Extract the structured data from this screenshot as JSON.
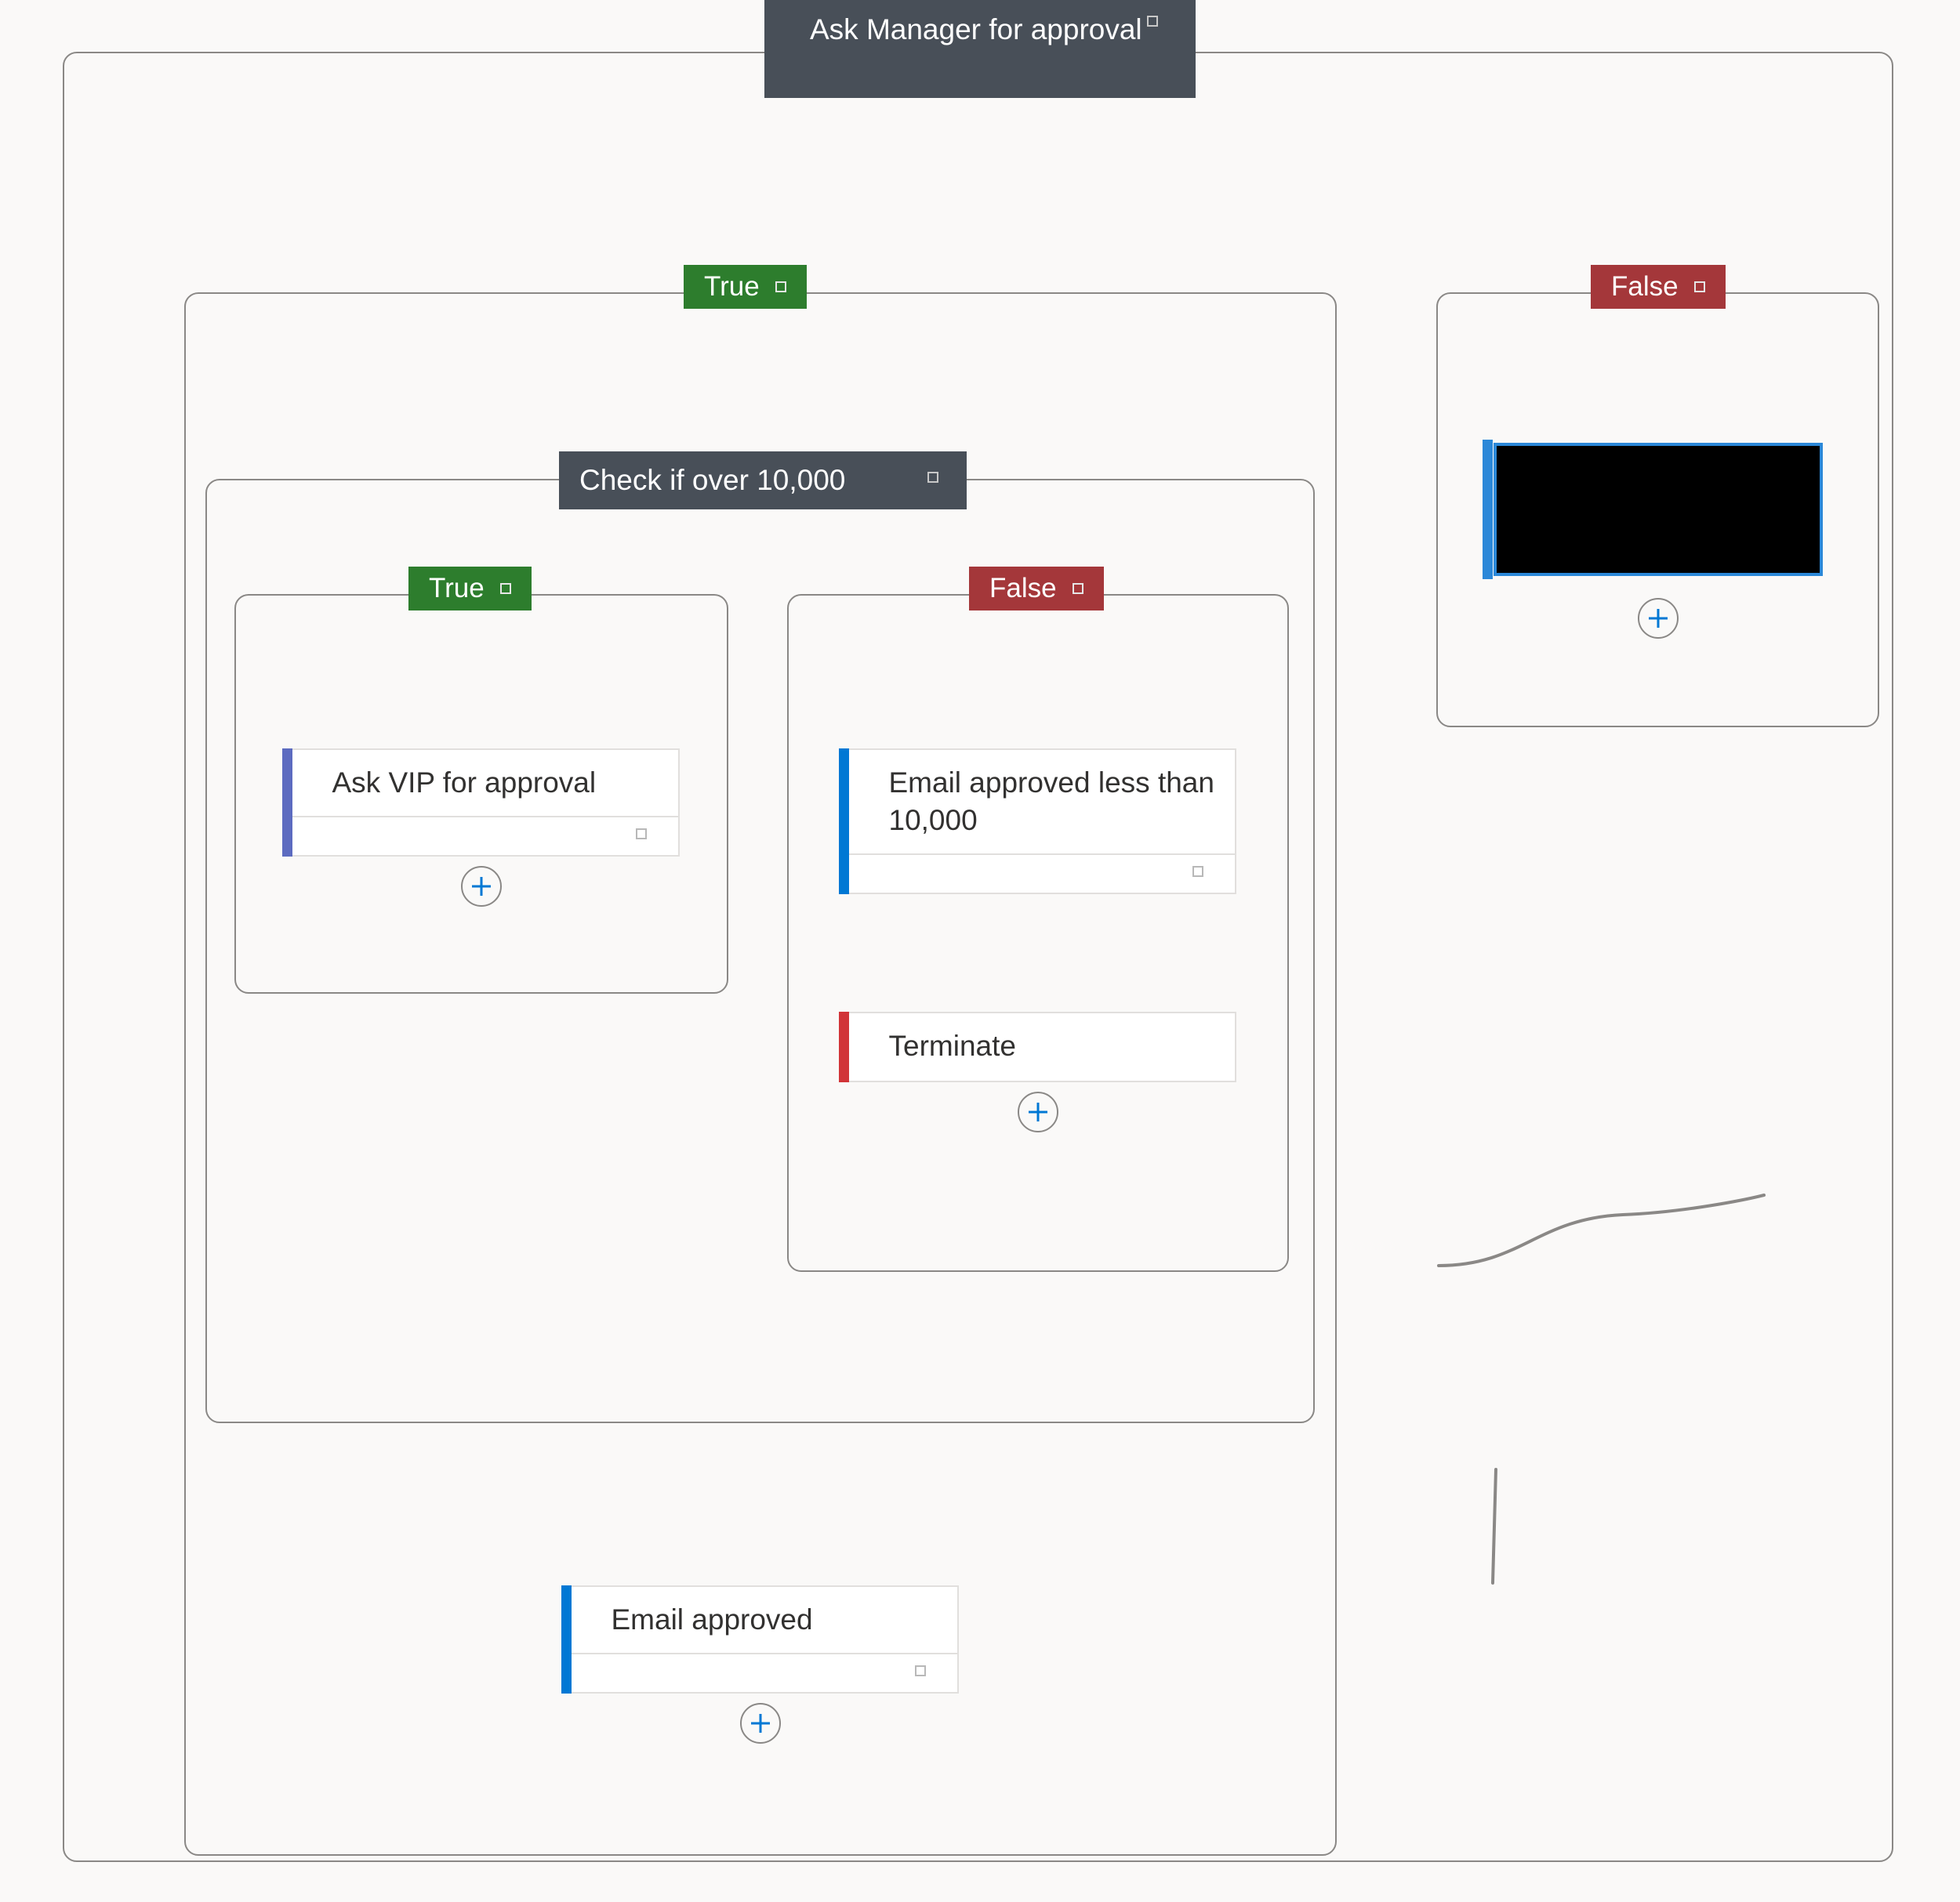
{
  "root": {
    "title": "Ask Manager for approval",
    "true_branch": {
      "tag": "True",
      "inner_condition": {
        "title": "Check if over 10,000",
        "true_branch": {
          "tag": "True",
          "action1": {
            "title": "Ask VIP for approval"
          }
        },
        "false_branch": {
          "tag": "False",
          "action1": {
            "title": "Email approved less than 10,000"
          },
          "action2": {
            "title": "Terminate"
          }
        }
      },
      "action_after": {
        "title": "Email approved"
      }
    },
    "false_branch": {
      "tag": "False"
    }
  },
  "colors": {
    "true_tag": "#2d7d2d",
    "false_tag": "#a4373a",
    "header_bg": "#484f58",
    "stripe_blue": "#0078d4",
    "stripe_purple": "#5c6bc0",
    "stripe_red": "#d13438",
    "plus_blue": "#0078d4"
  }
}
